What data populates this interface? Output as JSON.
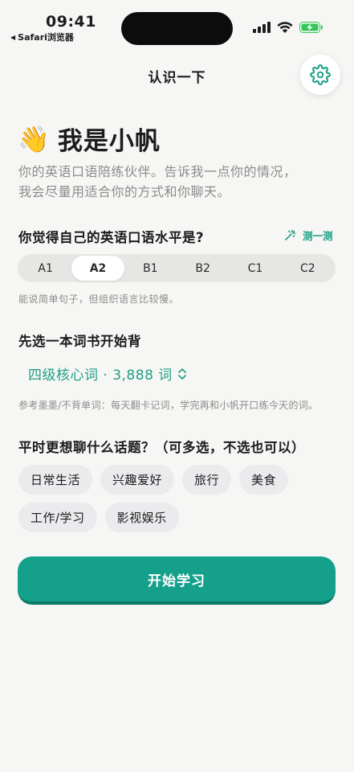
{
  "status_bar": {
    "time": "09:41",
    "back_app": "Safari浏览器",
    "icons": [
      "signal-icon",
      "wifi-icon",
      "battery-charging-icon"
    ]
  },
  "header": {
    "title": "认识一下",
    "settings_icon": "gear-icon"
  },
  "hero": {
    "emoji": "👋",
    "title": "我是小帆",
    "subtitle_line1": "你的英语口语陪练伙伴。告诉我一点你的情况，",
    "subtitle_line2": "我会尽量用适合你的方式和你聊天。"
  },
  "level": {
    "question": "你觉得自己的英语口语水平是?",
    "test_label": "测一测",
    "options": [
      "A1",
      "A2",
      "B1",
      "B2",
      "C1",
      "C2"
    ],
    "selected": "A2",
    "description": "能说简单句子，但组织语言比较慢。"
  },
  "book": {
    "title": "先选一本词书开始背",
    "selected": "四级核心词 · 3,888 词",
    "hint": "参考墨墨/不背单词：每天翻卡记词，学完再和小帆开口练今天的词。"
  },
  "topics": {
    "title": "平时更想聊什么话题？（可多选，不选也可以）",
    "chips": [
      "日常生活",
      "兴趣爱好",
      "旅行",
      "美食",
      "工作/学习",
      "影视娱乐"
    ]
  },
  "start_button": "开始学习",
  "colors": {
    "accent": "#14a08b",
    "accent_text": "#1e9f87",
    "background": "#f6f6f4",
    "chip_bg": "#ebebed",
    "battery_green": "#34c759"
  }
}
